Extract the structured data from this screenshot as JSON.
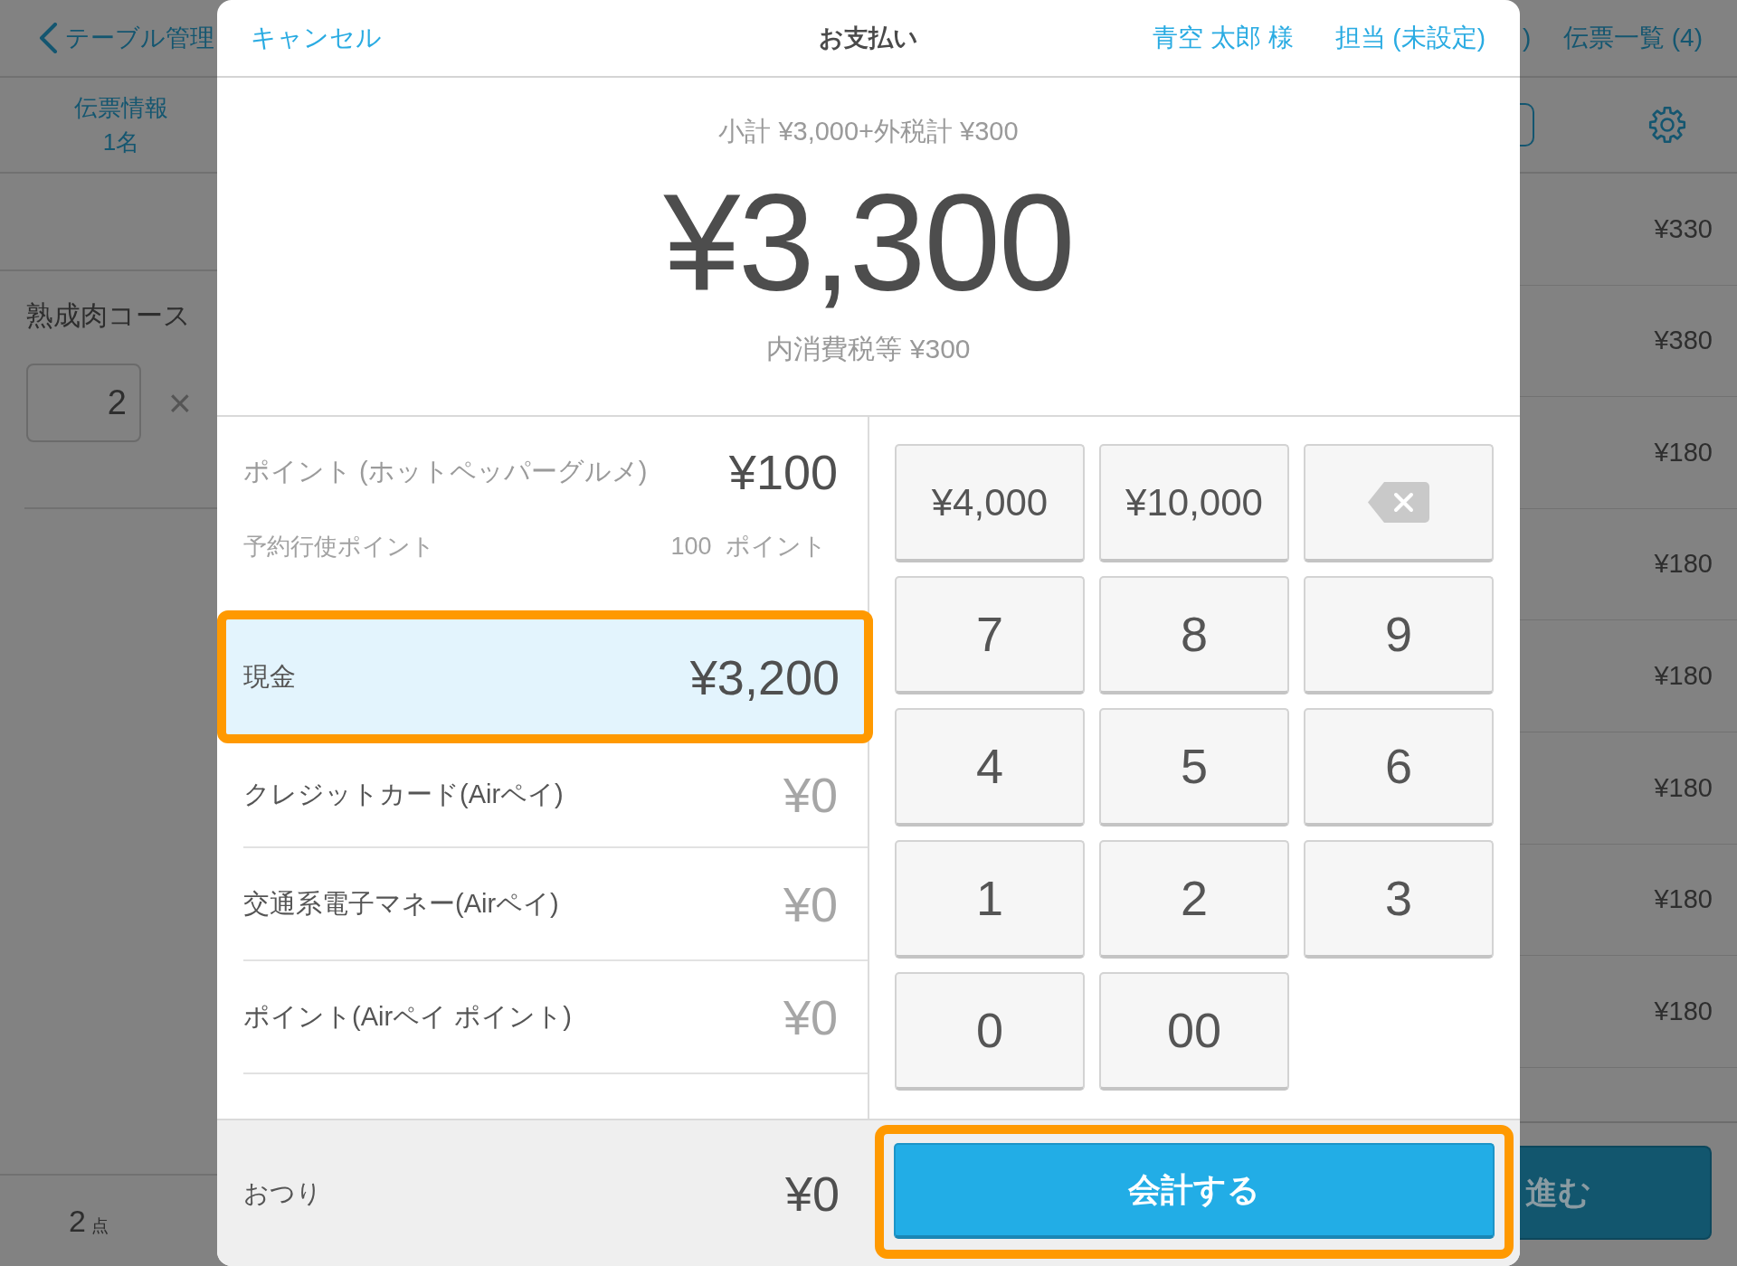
{
  "background": {
    "top_bar": {
      "back_link": "テーブル管理",
      "partial_link": ")",
      "slip_list_link": "伝票一覧 (4)"
    },
    "slip_info": {
      "title": "伝票情報",
      "guests": "1名"
    },
    "order_item": {
      "name": "熟成肉コース",
      "quantity": "2",
      "sign": "×"
    },
    "prices": [
      "¥330",
      "¥380",
      "¥180",
      "¥180",
      "¥180",
      "¥180",
      "¥180",
      "¥180"
    ],
    "item_count": {
      "number": "2",
      "unit": "点"
    },
    "next_button": "進む"
  },
  "dialog": {
    "header": {
      "cancel": "キャンセル",
      "title": "お支払い",
      "customer": "青空 太郎 様",
      "staff": "担当 (未設定)"
    },
    "summary": {
      "breakdown": "小計 ¥3,000+外税計 ¥300",
      "total": "¥3,300",
      "tax_note": "内消費税等 ¥300"
    },
    "payment_methods": [
      {
        "kind": "points",
        "label": "ポイント (ホットペッパーグルメ)",
        "amount": "¥100",
        "detail_label": "予約行使ポイント",
        "detail_value": "100 ポイント",
        "selected": false,
        "highlighted": false,
        "greyed": false
      },
      {
        "kind": "method",
        "label": "現金",
        "amount": "¥3,200",
        "selected": true,
        "highlighted": true,
        "greyed": false
      },
      {
        "kind": "method",
        "label": "クレジットカード(Airペイ)",
        "amount": "¥0",
        "selected": false,
        "highlighted": false,
        "greyed": true
      },
      {
        "kind": "method",
        "label": "交通系電子マネー(Airペイ)",
        "amount": "¥0",
        "selected": false,
        "highlighted": false,
        "greyed": true
      },
      {
        "kind": "method",
        "label": "ポイント(Airペイ ポイント)",
        "amount": "¥0",
        "selected": false,
        "highlighted": false,
        "greyed": true
      }
    ],
    "change": {
      "label": "おつり",
      "amount": "¥0"
    },
    "keypad": [
      {
        "kind": "amount",
        "label": "¥4,000"
      },
      {
        "kind": "amount",
        "label": "¥10,000"
      },
      {
        "kind": "backspace"
      },
      {
        "kind": "digit",
        "label": "7"
      },
      {
        "kind": "digit",
        "label": "8"
      },
      {
        "kind": "digit",
        "label": "9"
      },
      {
        "kind": "digit",
        "label": "4"
      },
      {
        "kind": "digit",
        "label": "5"
      },
      {
        "kind": "digit",
        "label": "6"
      },
      {
        "kind": "digit",
        "label": "1"
      },
      {
        "kind": "digit",
        "label": "2"
      },
      {
        "kind": "digit",
        "label": "3"
      },
      {
        "kind": "digit",
        "label": "0"
      },
      {
        "kind": "digit",
        "label": "00"
      }
    ],
    "checkout_button": {
      "label": "会計する",
      "highlighted": true
    }
  }
}
